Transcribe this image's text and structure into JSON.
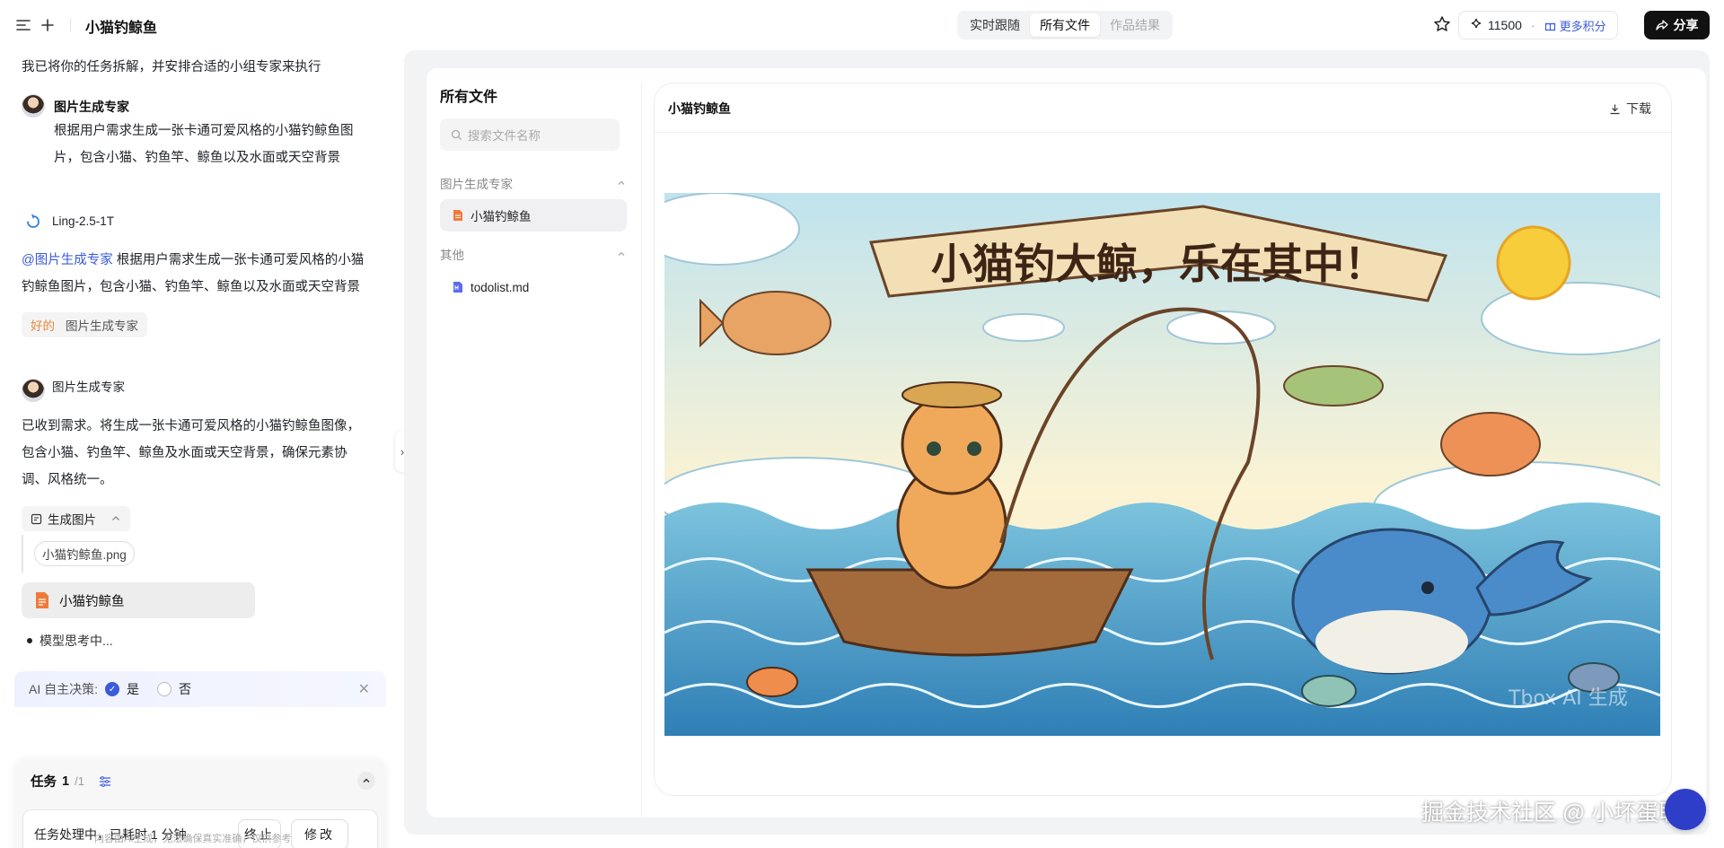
{
  "header": {
    "title": "小猫钓鲸鱼",
    "tabs": [
      {
        "label": "实时跟随",
        "state": "normal"
      },
      {
        "label": "所有文件",
        "state": "active"
      },
      {
        "label": "作品结果",
        "state": "disabled"
      }
    ],
    "credits": "11500",
    "more_credits": "更多积分",
    "share": "分享"
  },
  "chat": {
    "intro": "我已将你的任务拆解，并安排合适的小组专家来执行",
    "expert_name": "图片生成专家",
    "expert_task_line1": "根据用户需求生成一张卡通可爱风格的小猫钓鲸鱼图",
    "expert_task_line2": "片，包含小猫、钓鱼竿、鲸鱼以及水面或天空背景",
    "model_name": "Ling-2.5-1T",
    "mention": "@图片生成专家",
    "model_msg_line1": "根据用户需求生成一张卡通可爱风格的小猫",
    "model_msg_line2": "钓鲸鱼图片，包含小猫、钓鱼竿、鲸鱼以及水面或天空背景",
    "reply_ok": "好的",
    "reply_who": "图片生成专家",
    "expert_name2": "图片生成专家",
    "expert_reply_line1": "已收到需求。将生成一张卡通可爱风格的小猫钓鲸鱼图像，",
    "expert_reply_line2": "包含小猫、钓鱼竿、鲸鱼及水面或天空背景，确保元素协",
    "expert_reply_line3": "调、风格统一。",
    "tool_label": "生成图片",
    "tool_file": "小猫钓鲸鱼.png",
    "file_card": "小猫钓鲸鱼",
    "thinking": "模型思考中...",
    "decision_label": "AI 自主决策:",
    "decision_yes": "是",
    "decision_no": "否",
    "task_label": "任务",
    "task_current": "1",
    "task_total": "/1",
    "task_status": "任务处理中，已耗时 1 分钟",
    "task_stop": "终止",
    "task_edit": "修改",
    "disclaimer": "内容由AI生成，无法确保真实准确，仅供参考"
  },
  "files": {
    "title": "所有文件",
    "search_placeholder": "搜索文件名称",
    "group1": "图片生成专家",
    "group1_file": "小猫钓鲸鱼",
    "group2": "其他",
    "group2_file": "todolist.md"
  },
  "preview": {
    "title": "小猫钓鲸鱼",
    "download": "下载",
    "image_banner": "小猫钓大鲸，乐在其中！",
    "image_watermark": "Tbox AI 生成"
  },
  "watermark": "掘金技术社区 @ 小坏蛋联盟",
  "colors": {
    "accent": "#3b5bdb",
    "orange": "#e8873a",
    "share_bg": "#111111"
  }
}
